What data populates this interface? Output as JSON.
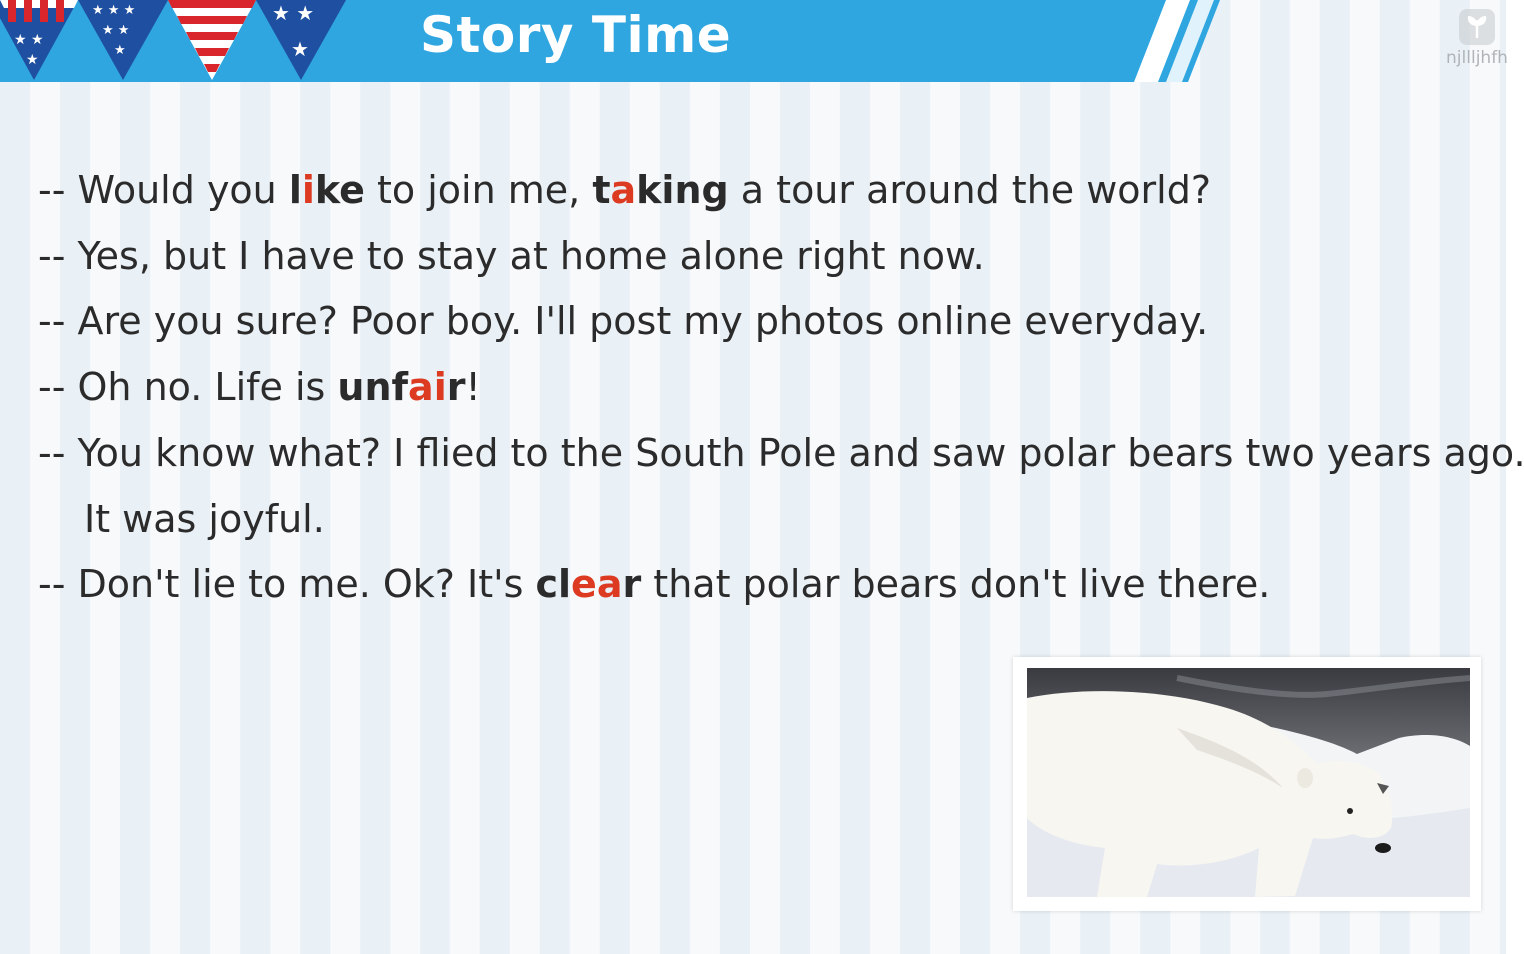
{
  "header": {
    "title": "Story Time",
    "bar_color": "#2fa6e0"
  },
  "watermark": {
    "text": "njllljhfh",
    "icon": "leaf-logo-icon"
  },
  "dialogue": [
    {
      "segments": [
        {
          "text": "-- Would you "
        },
        {
          "text": "l",
          "kw": true
        },
        {
          "text": "i",
          "kw": true,
          "hl": true
        },
        {
          "text": "ke",
          "kw": true
        },
        {
          "text": " to join me, "
        },
        {
          "text": "t",
          "kw": true
        },
        {
          "text": "a",
          "kw": true,
          "hl": true
        },
        {
          "text": "king",
          "kw": true
        },
        {
          "text": " a tour around the world?"
        }
      ]
    },
    {
      "segments": [
        {
          "text": "-- Yes, but I have to stay at home alone right now."
        }
      ]
    },
    {
      "segments": [
        {
          "text": "-- Are you sure? Poor boy. I'll post my photos online everyday."
        }
      ]
    },
    {
      "segments": [
        {
          "text": "-- Oh no. Life is "
        },
        {
          "text": "unf",
          "kw": true
        },
        {
          "text": "ai",
          "kw": true,
          "hl": true
        },
        {
          "text": "r",
          "kw": true
        },
        {
          "text": "!"
        }
      ]
    },
    {
      "segments": [
        {
          "text": "-- You know what? I flied to the South Pole and saw polar bears two years ago."
        }
      ]
    },
    {
      "cont": true,
      "segments": [
        {
          "text": "It was joyful."
        }
      ]
    },
    {
      "segments": [
        {
          "text": "-- Don't lie to me. Ok? It's "
        },
        {
          "text": "cl",
          "kw": true
        },
        {
          "text": "ea",
          "kw": true,
          "hl": true
        },
        {
          "text": "r",
          "kw": true
        },
        {
          "text": " that polar bears don't live there."
        }
      ]
    }
  ],
  "colors": {
    "highlight": "#dd3a22",
    "text": "#2b2b2b"
  },
  "photo": {
    "subject": "polar-bear-image"
  }
}
